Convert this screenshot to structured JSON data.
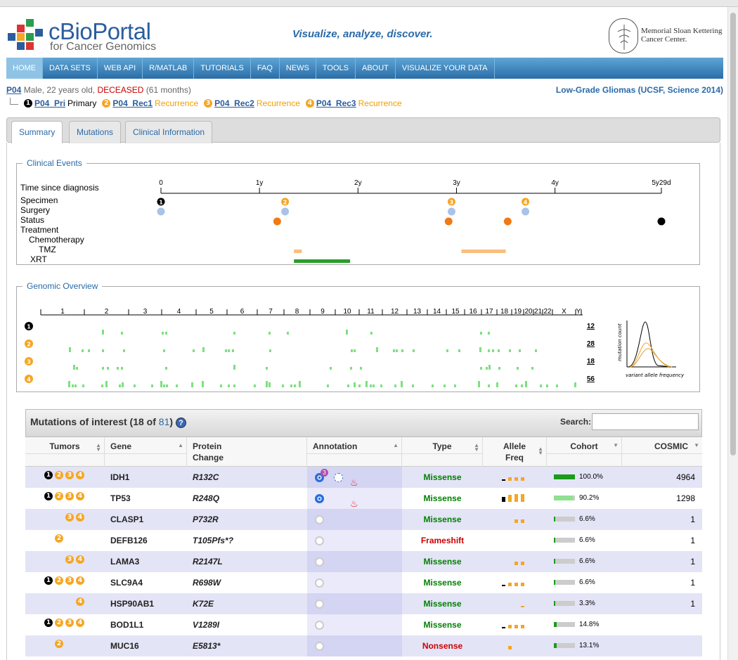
{
  "header": {
    "logo_name": "cBioPortal",
    "logo_sub": "for Cancer Genomics",
    "tagline": "Visualize, analyze, discover.",
    "institution_line1": "Memorial Sloan Kettering",
    "institution_line2": "Cancer Center."
  },
  "nav": [
    "HOME",
    "DATA SETS",
    "WEB API",
    "R/MATLAB",
    "TUTORIALS",
    "FAQ",
    "NEWS",
    "TOOLS",
    "ABOUT",
    "VISUALIZE YOUR DATA"
  ],
  "patient": {
    "id": "P04",
    "desc": "Male, 22 years old,",
    "status": "DECEASED",
    "months": "(61 months)",
    "study": "Low-Grade Gliomas (UCSF, Science 2014)",
    "samples": [
      {
        "n": "1",
        "id": "P04_Pri",
        "type": "Primary",
        "color": "black"
      },
      {
        "n": "2",
        "id": "P04_Rec1",
        "type": "Recurrence",
        "color": "orange"
      },
      {
        "n": "3",
        "id": "P04_Rec2",
        "type": "Recurrence",
        "color": "orange"
      },
      {
        "n": "4",
        "id": "P04_Rec3",
        "type": "Recurrence",
        "color": "orange"
      }
    ]
  },
  "tabs": [
    "Summary",
    "Mutations",
    "Clinical Information"
  ],
  "clinical_events": {
    "legend": "Clinical Events",
    "rows": [
      "Time since diagnosis",
      "Specimen",
      "Surgery",
      "Status",
      "Treatment",
      "Chemotherapy",
      "TMZ",
      "XRT"
    ],
    "ticks": [
      "0",
      "1y",
      "2y",
      "3y",
      "4y",
      "5y29d"
    ]
  },
  "genomic_overview": {
    "legend": "Genomic Overview",
    "chromosomes": [
      "1",
      "2",
      "3",
      "4",
      "5",
      "6",
      "7",
      "8",
      "9",
      "10",
      "11",
      "12",
      "13",
      "14",
      "15",
      "16",
      "17",
      "18",
      "19",
      "20",
      "21",
      "22",
      "X",
      "Y"
    ],
    "counts": [
      "12",
      "28",
      "18",
      "56"
    ],
    "vaf_ylabel": "mutation count",
    "vaf_xlabel": "variant allele frequency"
  },
  "mutations": {
    "title": "Mutations of interest (18 of",
    "total": "81",
    "title_end": ")",
    "help": "?",
    "search_label": "Search:",
    "columns": {
      "tumors": "Tumors",
      "gene": "Gene",
      "protein1": "Protein",
      "protein2": "Change",
      "annotation": "Annotation",
      "type": "Type",
      "allele1": "Allele",
      "allele2": "Freq",
      "cohort": "Cohort",
      "cosmic": "COSMIC"
    },
    "rows": [
      {
        "tumors": [
          "1",
          "2",
          "3",
          "4"
        ],
        "gene": "IDH1",
        "protein": "R132C",
        "oncokb": "on",
        "oncokb_badge": "3",
        "hotspot_dash": true,
        "flame": true,
        "type": "Missense",
        "af": [
          0.2,
          0.4,
          0.4,
          0.4
        ],
        "cohort": "100.0%",
        "cohort_frac": 1.0,
        "cosmic": "4964"
      },
      {
        "tumors": [
          "1",
          "2",
          "3",
          "4"
        ],
        "gene": "TP53",
        "protein": "R248Q",
        "oncokb": "on",
        "oncokb_badge": "",
        "hotspot_dash": false,
        "flame": true,
        "type": "Missense",
        "af": [
          0.55,
          0.85,
          0.95,
          0.95
        ],
        "cohort": "90.2%",
        "cohort_frac": 0.902,
        "cosmic": "1298"
      },
      {
        "tumors": [
          "",
          "",
          "3",
          "4"
        ],
        "gene": "CLASP1",
        "protein": "P732R",
        "oncokb": "off",
        "oncokb_badge": "",
        "hotspot_dash": false,
        "flame": false,
        "type": "Missense",
        "af": [
          0,
          0,
          0.4,
          0.4
        ],
        "cohort": "6.6%",
        "cohort_frac": 0.066,
        "cosmic": "1"
      },
      {
        "tumors": [
          "",
          "2",
          "",
          ""
        ],
        "gene": "DEFB126",
        "protein": "T105Pfs*?",
        "oncokb": "off",
        "oncokb_badge": "",
        "hotspot_dash": false,
        "flame": false,
        "type": "Frameshift",
        "af": [
          0,
          0,
          0,
          0
        ],
        "cohort": "6.6%",
        "cohort_frac": 0.066,
        "cosmic": "1"
      },
      {
        "tumors": [
          "",
          "",
          "3",
          "4"
        ],
        "gene": "LAMA3",
        "protein": "R2147L",
        "oncokb": "off",
        "oncokb_badge": "",
        "hotspot_dash": false,
        "flame": false,
        "type": "Missense",
        "af": [
          0,
          0,
          0.4,
          0.4
        ],
        "cohort": "6.6%",
        "cohort_frac": 0.066,
        "cosmic": "1"
      },
      {
        "tumors": [
          "1",
          "2",
          "3",
          "4"
        ],
        "gene": "SLC9A4",
        "protein": "R698W",
        "oncokb": "off",
        "oncokb_badge": "",
        "hotspot_dash": false,
        "flame": false,
        "type": "Missense",
        "af": [
          0.2,
          0.4,
          0.4,
          0.4
        ],
        "cohort": "6.6%",
        "cohort_frac": 0.066,
        "cosmic": "1"
      },
      {
        "tumors": [
          "",
          "",
          "",
          "4"
        ],
        "gene": "HSP90AB1",
        "protein": "K72E",
        "oncokb": "off",
        "oncokb_badge": "",
        "hotspot_dash": false,
        "flame": false,
        "type": "Missense",
        "af": [
          0,
          0,
          0,
          0.1
        ],
        "cohort": "3.3%",
        "cohort_frac": 0.033,
        "cosmic": "1"
      },
      {
        "tumors": [
          "1",
          "2",
          "3",
          "4"
        ],
        "gene": "BOD1L1",
        "protein": "V1289I",
        "oncokb": "off",
        "oncokb_badge": "",
        "hotspot_dash": false,
        "flame": false,
        "type": "Missense",
        "af": [
          0.2,
          0.4,
          0.4,
          0.4
        ],
        "cohort": "14.8%",
        "cohort_frac": 0.148,
        "cosmic": ""
      },
      {
        "tumors": [
          "",
          "2",
          "",
          ""
        ],
        "gene": "MUC16",
        "protein": "E5813*",
        "oncokb": "off",
        "oncokb_badge": "",
        "hotspot_dash": false,
        "flame": false,
        "type": "Nonsense",
        "af": [
          0,
          0.4,
          0,
          0
        ],
        "cohort": "13.1%",
        "cohort_frac": 0.131,
        "cosmic": ""
      }
    ]
  },
  "colors": {
    "black_sample": "#000000",
    "orange_sample": "#f5a623",
    "missense": "#008000",
    "truncating": "#cc0000",
    "link": "#2a6aa8",
    "mutation_tick": "#7ee07e"
  }
}
